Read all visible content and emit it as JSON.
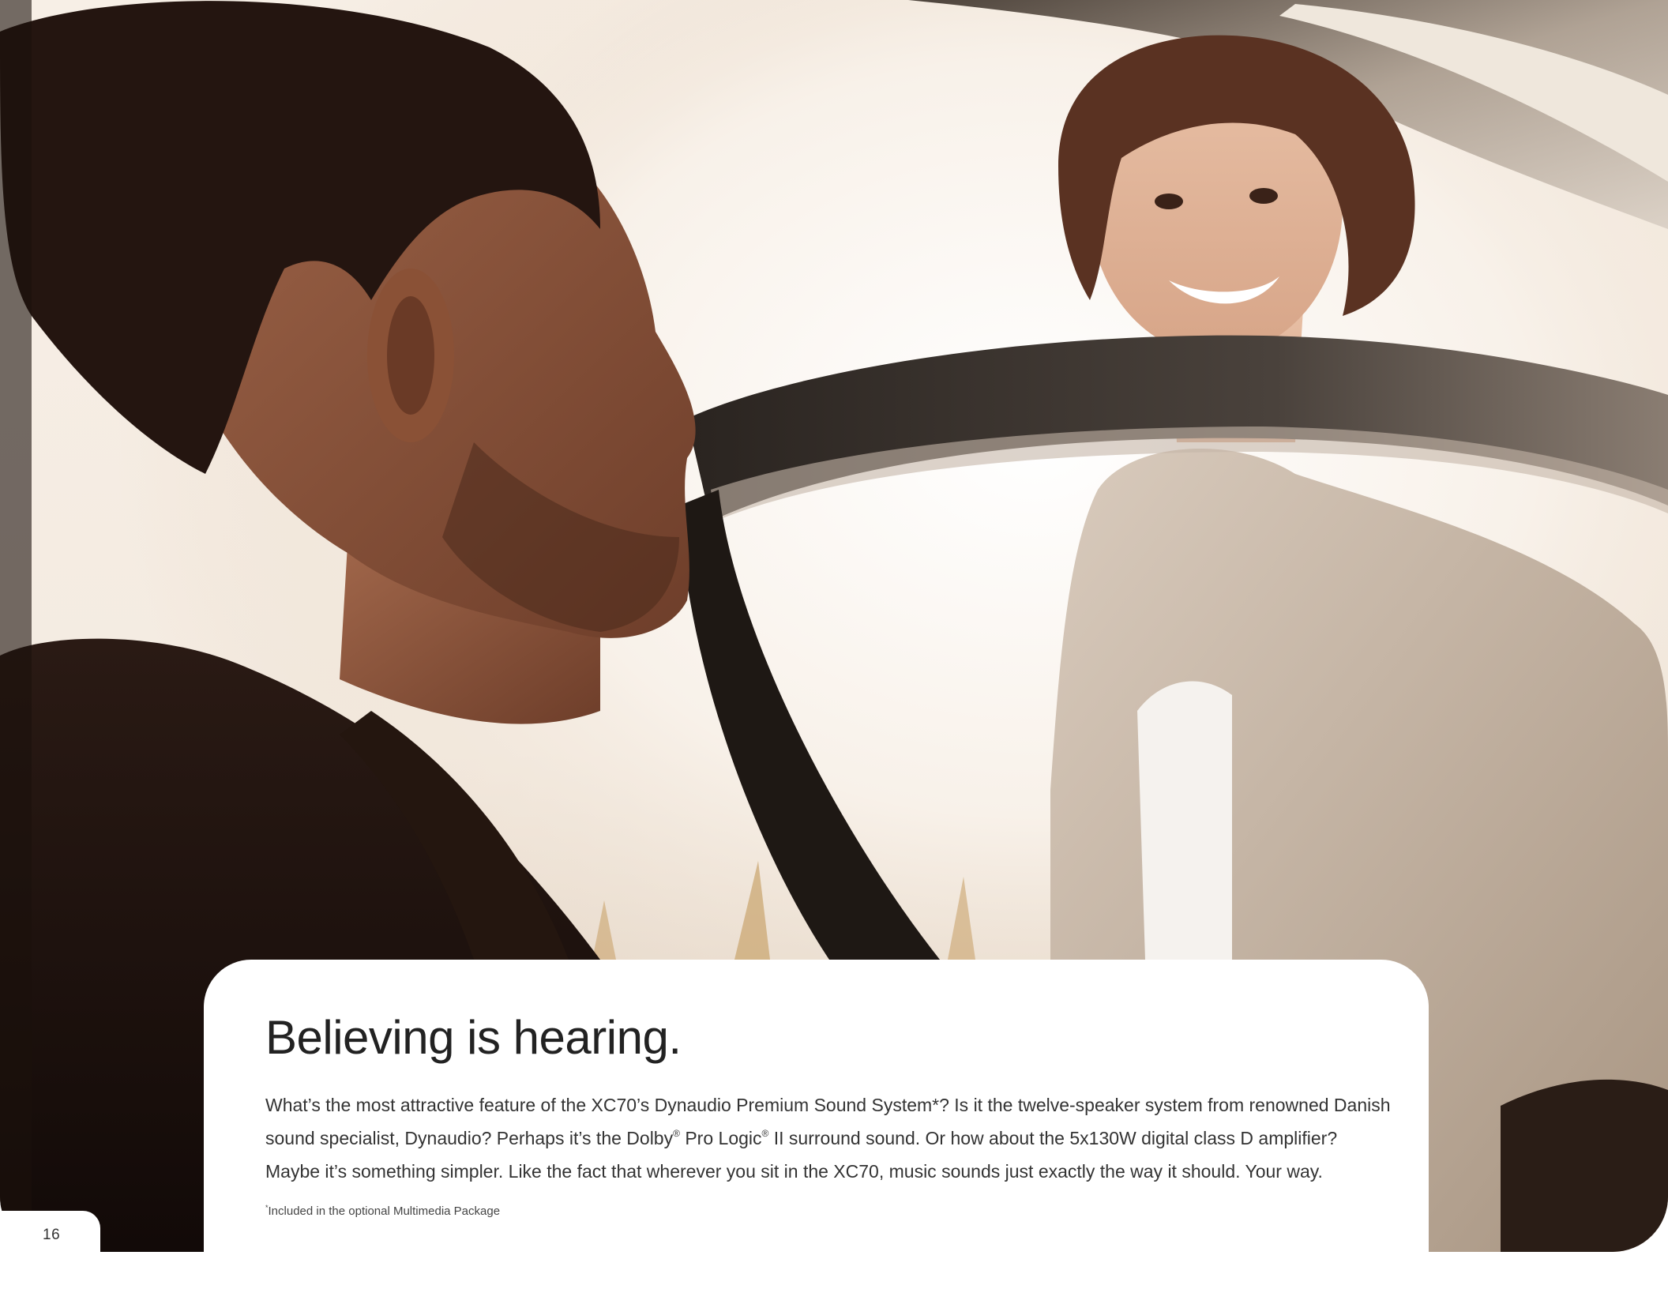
{
  "page": {
    "number": "16"
  },
  "headline": "Believing is hearing.",
  "body": {
    "line1": "What’s the most attractive feature of the XC70’s Dynaudio Premium Sound System*? Is it the twelve-speaker system from renowned Danish",
    "line2_part1": "sound specialist, Dynaudio? Perhaps it’s the Dolby",
    "line2_reg1": "®",
    "line2_part2": " Pro Logic",
    "line2_reg2": "®",
    "line2_part3": " II surround sound. Or how about the 5x130W digital class D amplifier?",
    "line3": "Maybe it’s something simpler. Like the fact that wherever you sit in the XC70, music sounds just exactly the way it should. Your way."
  },
  "footnote": {
    "marker": "*",
    "text": "Included in the optional Multimedia Package"
  },
  "colors": {
    "text_dark": "#222222",
    "text_body": "#333333",
    "card_background": "#ffffff"
  }
}
